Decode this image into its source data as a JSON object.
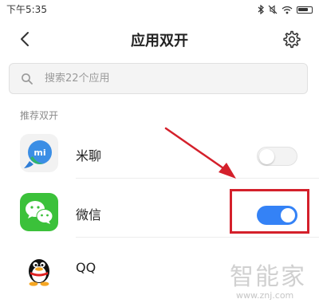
{
  "status_bar": {
    "time": "下午5:35",
    "icons": [
      "bluetooth-icon",
      "mute-icon",
      "wifi-icon",
      "battery-icon"
    ]
  },
  "header": {
    "title": "应用双开",
    "back_icon": "chevron-left-icon",
    "settings_icon": "gear-icon"
  },
  "search": {
    "placeholder": "搜索22个应用",
    "value": ""
  },
  "section": {
    "label": "推荐双开"
  },
  "apps": [
    {
      "name": "米聊",
      "icon": "mi-talk-app-icon",
      "icon_text": "mi",
      "dual_enabled": false
    },
    {
      "name": "微信",
      "icon": "wechat-app-icon",
      "dual_enabled": true
    },
    {
      "name": "QQ",
      "icon": "qq-app-icon",
      "dual_enabled": null
    }
  ],
  "colors": {
    "toggle_on": "#3482f6",
    "highlight": "#d4202b",
    "wechat_green": "#3bc13a"
  },
  "watermark": {
    "text": "智能家",
    "url": "www.znj.com"
  }
}
